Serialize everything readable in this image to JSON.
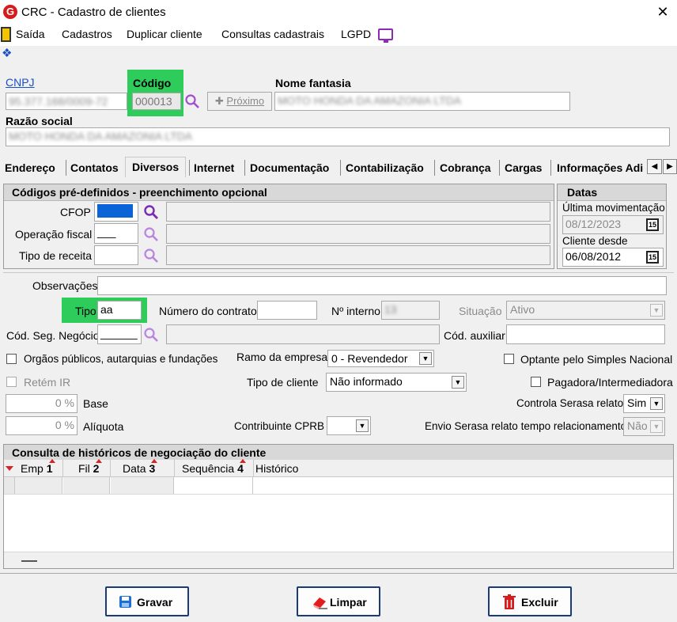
{
  "window": {
    "app_icon": "G",
    "title": "CRC - Cadastro de clientes",
    "close": "✕"
  },
  "menu": {
    "saida": "Saída",
    "cadastros": "Cadastros",
    "duplicar": "Duplicar cliente",
    "consultas": "Consultas cadastrais",
    "lgpd": "LGPD"
  },
  "header": {
    "cnpj_label": "CNPJ",
    "cnpj_value": "95.377.168/0009-72",
    "codigo_label": "Código",
    "codigo_value": "000013",
    "proximo_label": "Próximo",
    "nome_fantasia_label": "Nome fantasia",
    "nome_fantasia_value": "MOTO HONDA DA AMAZONIA LTDA",
    "razao_social_label": "Razão social",
    "razao_social_value": "MOTO HONDA DA AMAZONIA LTDA"
  },
  "tabs": [
    "Endereço",
    "Contatos",
    "Diversos",
    "Internet",
    "Documentação",
    "Contabilização",
    "Cobrança",
    "Cargas",
    "Informações Adi"
  ],
  "codigos": {
    "title": "Códigos pré-definidos - preenchimento opcional",
    "cfop_label": "CFOP",
    "operacao_label": "Operação fiscal",
    "operacao_value": "___",
    "tipo_receita_label": "Tipo de receita"
  },
  "datas": {
    "title": "Datas",
    "ultima_label": "Última movimentação",
    "ultima_value": "08/12/2023",
    "cliente_desde_label": "Cliente desde",
    "cliente_desde_value": "06/08/2012",
    "cal_glyph": "15"
  },
  "form": {
    "observacoes_label": "Observações",
    "tipo_label": "Tipo",
    "tipo_value": "aa",
    "numero_contrato_label": "Número do contrato",
    "n_interno_label": "Nº interno",
    "n_interno_value": "13",
    "situacao_label": "Situação",
    "situacao_value": "Ativo",
    "cod_seg_label": "Cód. Seg. Negócio",
    "cod_seg_value": "______",
    "cod_aux_label": "Cód. auxiliar",
    "orgaos_label": "Orgãos públicos, autarquias e fundações",
    "ramo_label": "Ramo da empresa",
    "ramo_value": "0 - Revendedor",
    "optante_label": "Optante pelo Simples Nacional",
    "retem_label": "Retém IR",
    "tipo_cliente_label": "Tipo de cliente",
    "tipo_cliente_value": "Não informado",
    "pagadora_label": "Pagadora/Intermediadora",
    "base_value": "0 %",
    "base_label": "Base",
    "controla_label": "Controla Serasa relato",
    "controla_value": "Sim",
    "aliquota_value": "0 %",
    "aliquota_label": "Alíquota",
    "contribuinte_label": "Contribuinte CPRB",
    "envio_label": "Envio Serasa relato tempo relacionamento",
    "envio_value": "Não"
  },
  "historico": {
    "title": "Consulta de históricos de negociação do cliente",
    "columns": [
      {
        "name": "Emp",
        "badge": "1"
      },
      {
        "name": "Fil",
        "badge": "2"
      },
      {
        "name": "Data",
        "badge": "3"
      },
      {
        "name": "Sequência",
        "badge": "4"
      },
      {
        "name": "Histórico",
        "badge": ""
      }
    ]
  },
  "actions": {
    "gravar": "Gravar",
    "limpar": "Limpar",
    "excluir": "Excluir"
  },
  "colors": {
    "highlight": "#2ecc5b",
    "accent_blue": "#1a4fc4",
    "button_border": "#1a3b78",
    "danger_red": "#d41c1c",
    "lgpd_purple": "#8e2ab6"
  }
}
